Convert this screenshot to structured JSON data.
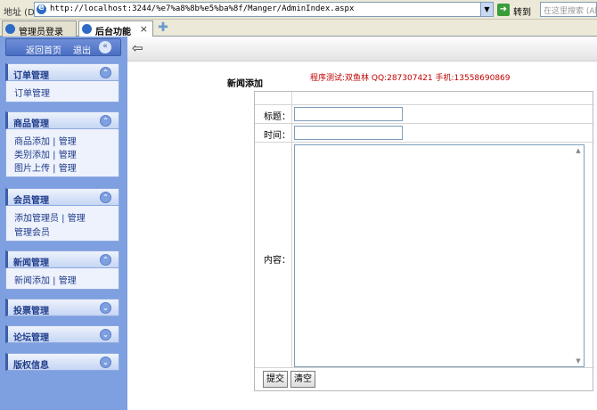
{
  "browser": {
    "address_label": "地址 (D)",
    "url": "http://localhost:3244/%e7%a8%8b%e5%ba%8f/Manger/AdminIndex.aspx",
    "go_label": "转到",
    "search_placeholder": "在这里搜索 (Al",
    "tabs": [
      {
        "label": "管理员登录"
      },
      {
        "label": "后台功能"
      }
    ],
    "tab_close": "×"
  },
  "sidebar": {
    "home_label": "返回首页",
    "logout_label": "退出",
    "sections": [
      {
        "title": "订单管理",
        "items": [
          "订单管理"
        ]
      },
      {
        "title": "商品管理",
        "items": [
          "商品添加 | 管理",
          "类别添加 | 管理",
          "图片上传 | 管理"
        ]
      },
      {
        "title": "会员管理",
        "items": [
          "添加管理员 | 管理",
          "管理会员"
        ]
      },
      {
        "title": "新闻管理",
        "items": [
          "新闻添加 | 管理"
        ]
      },
      {
        "title": "投票管理",
        "items": []
      },
      {
        "title": "论坛管理",
        "items": []
      },
      {
        "title": "版权信息",
        "items": []
      }
    ]
  },
  "main": {
    "form_title": "新闻添加",
    "test_info": "程序测试:双鱼林 QQ:287307421 手机:13558690869",
    "fields": {
      "title_label": "标题：",
      "time_label": "时间：",
      "content_label": "内容："
    },
    "buttons": {
      "submit": "提交",
      "clear": "清空"
    }
  },
  "icons": [
    "ie-icon",
    "dropdown-arrow-icon",
    "go-arrow-icon",
    "new-tab-icon",
    "collapse-icon",
    "back-arrow-icon",
    "toggle-icon"
  ]
}
